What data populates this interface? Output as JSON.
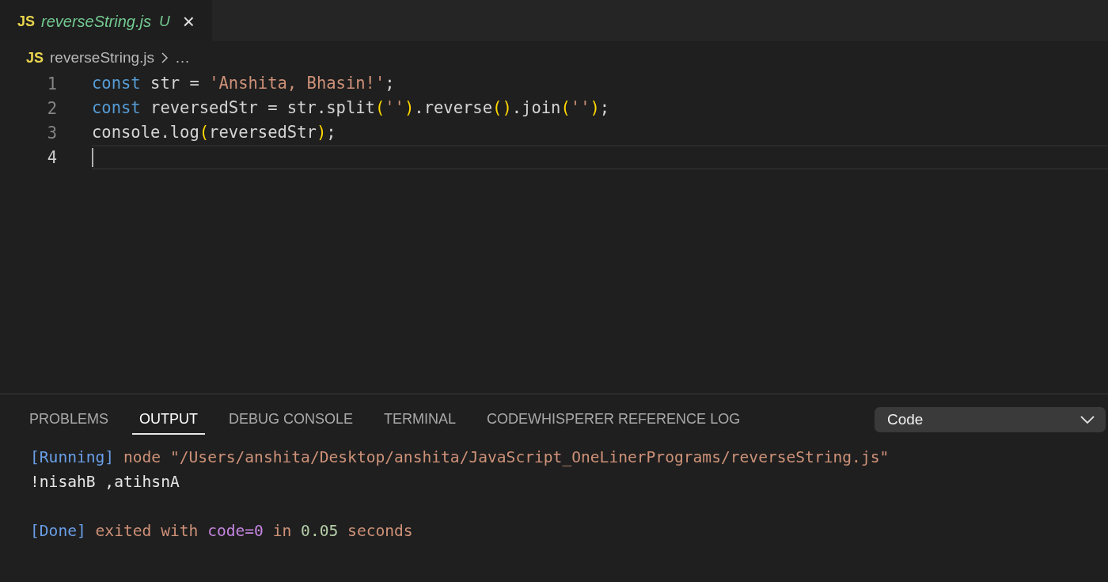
{
  "tabs": [
    {
      "icon": "JS",
      "label": "reverseString.js",
      "status": "U",
      "close": "×",
      "selected": true,
      "preview": true
    }
  ],
  "breadcrumb": {
    "icon": "JS",
    "file": "reverseString.js",
    "more": "…"
  },
  "editor": {
    "lines": [
      {
        "number": "1",
        "current": false,
        "tokens": [
          {
            "kind": "keyword",
            "text": "const"
          },
          {
            "kind": "plain",
            "text": " str = "
          },
          {
            "kind": "string",
            "text": "'Anshita, Bhasin!'"
          },
          {
            "kind": "plain",
            "text": ";"
          }
        ]
      },
      {
        "number": "2",
        "current": false,
        "tokens": [
          {
            "kind": "keyword",
            "text": "const"
          },
          {
            "kind": "plain",
            "text": " reversedStr = str.split"
          },
          {
            "kind": "bracket",
            "text": "("
          },
          {
            "kind": "string",
            "text": "''"
          },
          {
            "kind": "bracket",
            "text": ")"
          },
          {
            "kind": "plain",
            "text": ".reverse"
          },
          {
            "kind": "bracket",
            "text": "()"
          },
          {
            "kind": "plain",
            "text": ".join"
          },
          {
            "kind": "bracket",
            "text": "("
          },
          {
            "kind": "string",
            "text": "''"
          },
          {
            "kind": "bracket",
            "text": ")"
          },
          {
            "kind": "plain",
            "text": ";"
          }
        ]
      },
      {
        "number": "3",
        "current": false,
        "tokens": [
          {
            "kind": "plain",
            "text": "console.log"
          },
          {
            "kind": "bracket",
            "text": "("
          },
          {
            "kind": "plain",
            "text": "reversedStr"
          },
          {
            "kind": "bracket",
            "text": ")"
          },
          {
            "kind": "plain",
            "text": ";"
          }
        ]
      },
      {
        "number": "4",
        "current": true
      }
    ]
  },
  "panel": {
    "tabs": [
      {
        "label": "PROBLEMS",
        "selected": false
      },
      {
        "label": "OUTPUT",
        "selected": true
      },
      {
        "label": "DEBUG CONSOLE",
        "selected": false
      },
      {
        "label": "TERMINAL",
        "selected": false
      },
      {
        "label": "CODEWHISPERER REFERENCE LOG",
        "selected": false
      }
    ],
    "channel_select": {
      "value": "Code"
    },
    "output": [
      {
        "kind": "text",
        "tokens": [
          {
            "kind": "tag",
            "text": "[Running]"
          },
          {
            "kind": "text",
            "text": " node \"/Users/anshita/Desktop/anshita/JavaScript_OneLinerPrograms/reverseString.js\""
          }
        ]
      },
      {
        "kind": "text",
        "tokens": [
          {
            "kind": "plain",
            "text": "!nisahB ,atihsnA"
          }
        ]
      },
      {
        "kind": "blank"
      },
      {
        "kind": "text",
        "tokens": [
          {
            "kind": "tag",
            "text": "[Done]"
          },
          {
            "kind": "text",
            "text": " exited with "
          },
          {
            "kind": "code",
            "text": "code=0"
          },
          {
            "kind": "text",
            "text": " in "
          },
          {
            "kind": "number",
            "text": "0.05"
          },
          {
            "kind": "text",
            "text": " seconds"
          }
        ]
      }
    ]
  }
}
